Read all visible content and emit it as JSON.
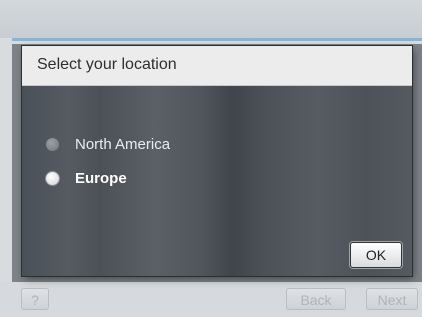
{
  "dialog": {
    "title": "Select your location",
    "options": [
      {
        "label": "North America",
        "selected": false
      },
      {
        "label": "Europe",
        "selected": true
      }
    ],
    "ok_label": "OK"
  },
  "bottom_bar": {
    "help_label": "?",
    "back_label": "Back",
    "next_label": "Next"
  }
}
